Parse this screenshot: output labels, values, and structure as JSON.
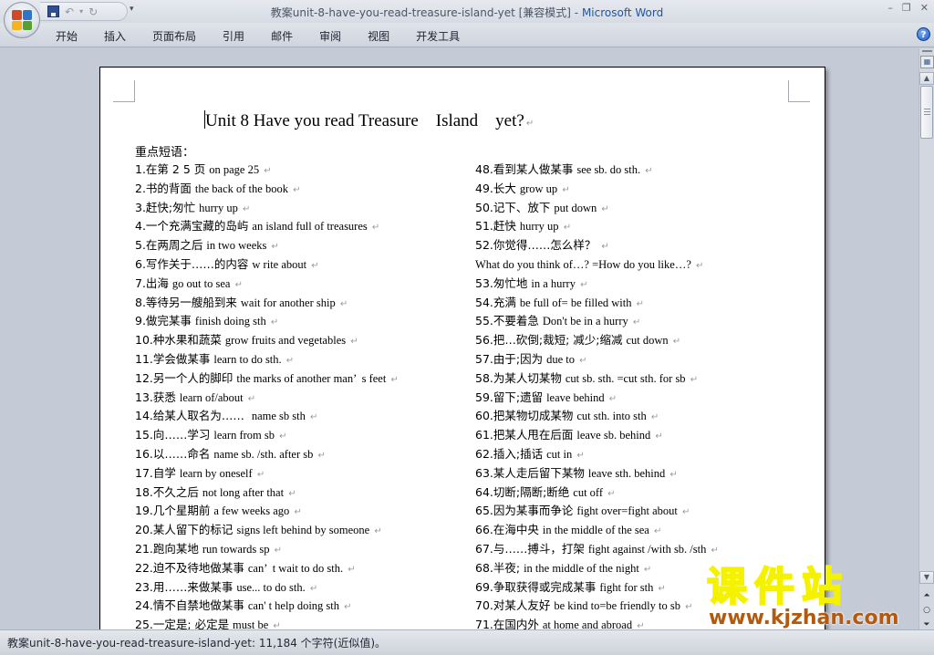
{
  "window": {
    "title_doc": "教案unit-8-have-you-read-treasure-island-yet [兼容模式]",
    "title_sep": " - ",
    "title_app": "Microsoft Word",
    "controls": {
      "minimize": "–",
      "restore": "❐",
      "close": "✕"
    }
  },
  "quick_access": {
    "undo": "↶",
    "undo_dropdown": "▾",
    "redo": "↻",
    "customize": "▾"
  },
  "ribbon": {
    "tabs": [
      "开始",
      "插入",
      "页面布局",
      "引用",
      "邮件",
      "审阅",
      "视图",
      "开发工具"
    ],
    "help": "?"
  },
  "document": {
    "title": "Unit 8 Have you read Treasure    Island    yet?",
    "section_label": "重点短语：",
    "left_column": [
      {
        "cn": "1.在第 2 5 页 ",
        "en": "on page 25 "
      },
      {
        "cn": "2.书的背面 ",
        "en": "the back of the book "
      },
      {
        "cn": "3.赶快;匆忙 ",
        "en": "hurry up "
      },
      {
        "cn": "4.一个充满宝藏的岛屿 ",
        "en": "an island full of treasures "
      },
      {
        "cn": "5.在两周之后 ",
        "en": "in two weeks "
      },
      {
        "cn": "6.写作关于……的内容 ",
        "en": "w rite about "
      },
      {
        "cn": "7.出海 ",
        "en": "go out to sea "
      },
      {
        "cn": "8.等待另一艘船到来 ",
        "en": "wait for another ship "
      },
      {
        "cn": "9.做完某事 ",
        "en": "finish doing sth "
      },
      {
        "cn": "10.种水果和蔬菜 ",
        "en": "grow fruits and vegetables "
      },
      {
        "cn": "11.学会做某事 ",
        "en": "learn to do sth. "
      },
      {
        "cn": "12.另一个人的脚印 ",
        "en": "the marks of another man’  s feet "
      },
      {
        "cn": "13.获悉 ",
        "en": "learn of/about "
      },
      {
        "cn": "14.给某人取名为……  ",
        "en": "name sb sth "
      },
      {
        "cn": "15.向……学习 ",
        "en": "learn from sb "
      },
      {
        "cn": "16.以……命名 ",
        "en": "name sb. /sth. after sb "
      },
      {
        "cn": "17.自学 ",
        "en": "learn by oneself "
      },
      {
        "cn": "18.不久之后 ",
        "en": "not long after that "
      },
      {
        "cn": "19.几个星期前 ",
        "en": "a few weeks ago "
      },
      {
        "cn": "20.某人留下的标记 ",
        "en": "signs left behind by someone "
      },
      {
        "cn": "21.跑向某地 ",
        "en": "run towards sp "
      },
      {
        "cn": "22.迫不及待地做某事 ",
        "en": "can’  t wait to do sth. "
      },
      {
        "cn": "23.用……来做某事 ",
        "en": "use... to do sth. "
      },
      {
        "cn": "24.情不自禁地做某事 ",
        "en": "can' t help doing sth "
      },
      {
        "cn": "25.一定是; 必定是 ",
        "en": "must be "
      }
    ],
    "right_column": [
      {
        "cn": "48.看到某人做某事 ",
        "en": "see sb. do sth. "
      },
      {
        "cn": "49.长大 ",
        "en": "grow up "
      },
      {
        "cn": "50.记下、放下 ",
        "en": "put down "
      },
      {
        "cn": "51.赶快 ",
        "en": "hurry up "
      },
      {
        "cn": "52.你觉得……怎么样？ ",
        "en": ""
      },
      {
        "cn": "",
        "en": "What do you think of…? =How do you like…? "
      },
      {
        "cn": "53.匆忙地 ",
        "en": "in a hurry "
      },
      {
        "cn": "54.充满 ",
        "en": "be full of= be filled with "
      },
      {
        "cn": "55.不要着急 ",
        "en": "Don't be in a hurry "
      },
      {
        "cn": "56.把…砍倒;裁短; 减少;缩减 ",
        "en": "cut down "
      },
      {
        "cn": "57.由于;因为 ",
        "en": "due to "
      },
      {
        "cn": "58.为某人切某物 ",
        "en": "cut sb. sth. =cut sth. for sb "
      },
      {
        "cn": "59.留下;遗留 ",
        "en": "leave behind "
      },
      {
        "cn": "60.把某物切成某物 ",
        "en": "cut sth. into sth "
      },
      {
        "cn": "61.把某人甩在后面 ",
        "en": "leave sb. behind "
      },
      {
        "cn": "62.插入;插话 ",
        "en": "cut in "
      },
      {
        "cn": "63.某人走后留下某物 ",
        "en": "leave sth. behind "
      },
      {
        "cn": "64.切断;隔断;断绝 ",
        "en": "cut off "
      },
      {
        "cn": "65.因为某事而争论 ",
        "en": "fight over=fight about "
      },
      {
        "cn": "66.在海中央 ",
        "en": "in the middle of the sea "
      },
      {
        "cn": "67.与……搏斗，打架 ",
        "en": "fight against /with sb. /sth "
      },
      {
        "cn": "68.半夜; ",
        "en": "in the middle of the night "
      },
      {
        "cn": "69.争取获得或完成某事 ",
        "en": "fight for sth "
      },
      {
        "cn": "70.对某人友好 ",
        "en": "be kind to=be friendly to sb "
      },
      {
        "cn": "71.在国内外 ",
        "en": "at home and abroad "
      }
    ],
    "paragraph_mark": "↵"
  },
  "scrollbar": {
    "up": "▲",
    "down": "▼",
    "prev_page": "⏶",
    "browse_object": "○",
    "next_page": "⏷",
    "ruler_toggle": "▦"
  },
  "status_bar": {
    "text": "教案unit-8-have-you-read-treasure-island-yet: 11,184 个字符(近似值)。"
  },
  "watermark": {
    "cn": "课件站",
    "url": "www.kjzhan.com"
  },
  "colors": {
    "office_red": "#d24726",
    "office_green": "#57a131",
    "office_blue": "#2e75c7",
    "office_yellow": "#f6b31b",
    "word_title_blue": "#1f55a8",
    "watermark_green": "#5a8a00",
    "watermark_orange": "#b25a10"
  }
}
